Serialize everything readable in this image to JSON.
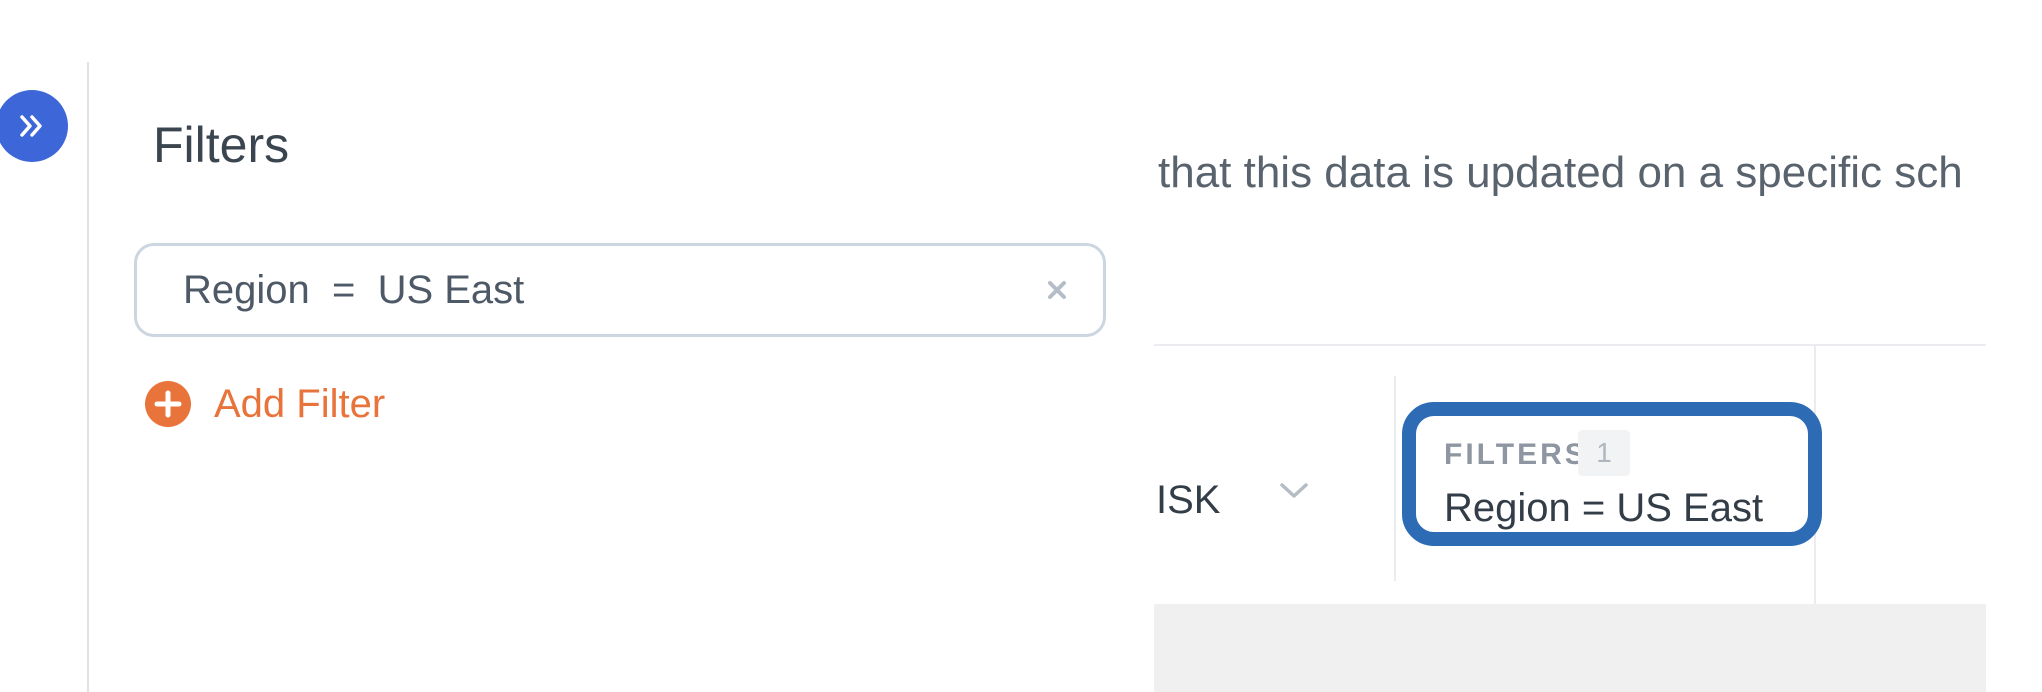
{
  "sidebar": {
    "title": "Filters",
    "filters": [
      {
        "field": "Region",
        "operator": "=",
        "value": "US East",
        "display": "Region  =  US East"
      }
    ],
    "add_filter_label": "Add Filter",
    "colors": {
      "accent": "#e8733b",
      "collapse_button": "#3d66d8"
    },
    "icons": {
      "collapse": "double-chevron-right-icon",
      "remove": "close-icon",
      "add": "plus-circle-icon"
    }
  },
  "main": {
    "description_text": "that this data is updated on a specific sch",
    "column_label": "ISK",
    "filters_summary": {
      "label": "FILTERS",
      "count": "1",
      "value": "Region = US East",
      "highlight_color": "#2d6cb5"
    },
    "icons": {
      "column_menu": "chevron-down-icon"
    }
  }
}
